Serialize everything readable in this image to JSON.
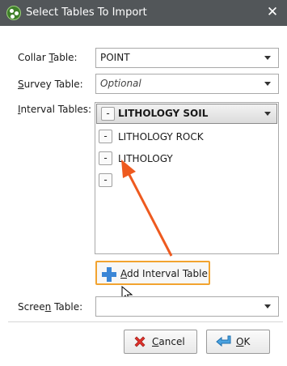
{
  "window": {
    "title": "Select Tables To Import",
    "close_glyph": "✕"
  },
  "collar": {
    "label_pre": "Collar ",
    "label_key": "T",
    "label_post": "able:",
    "value": "POINT"
  },
  "survey": {
    "label_key": "S",
    "label_post": "urvey Table:",
    "placeholder": "Optional"
  },
  "interval": {
    "label_key": "I",
    "label_post": "nterval Tables:",
    "remove_glyph": "-",
    "rows": [
      {
        "label": "LITHOLOGY SOIL",
        "selected": true
      },
      {
        "label": "LITHOLOGY ROCK",
        "selected": false
      },
      {
        "label": "LITHOLOGY",
        "selected": false
      },
      {
        "label": "",
        "selected": false
      }
    ]
  },
  "add_button": {
    "label_key": "A",
    "label_post": "dd Interval Table",
    "icon": "plus-icon"
  },
  "screen": {
    "label_pre": "Scree",
    "label_key": "n",
    "label_post": " Table:",
    "value": ""
  },
  "buttons": {
    "cancel_key": "C",
    "cancel_post": "ancel",
    "ok_key": "O",
    "ok_post": "K"
  },
  "colors": {
    "titlebar": "#525659",
    "annotation_arrow": "#ee5a1f",
    "add_button_border": "#f2a32f",
    "plus_blue": "#3b86d6"
  }
}
